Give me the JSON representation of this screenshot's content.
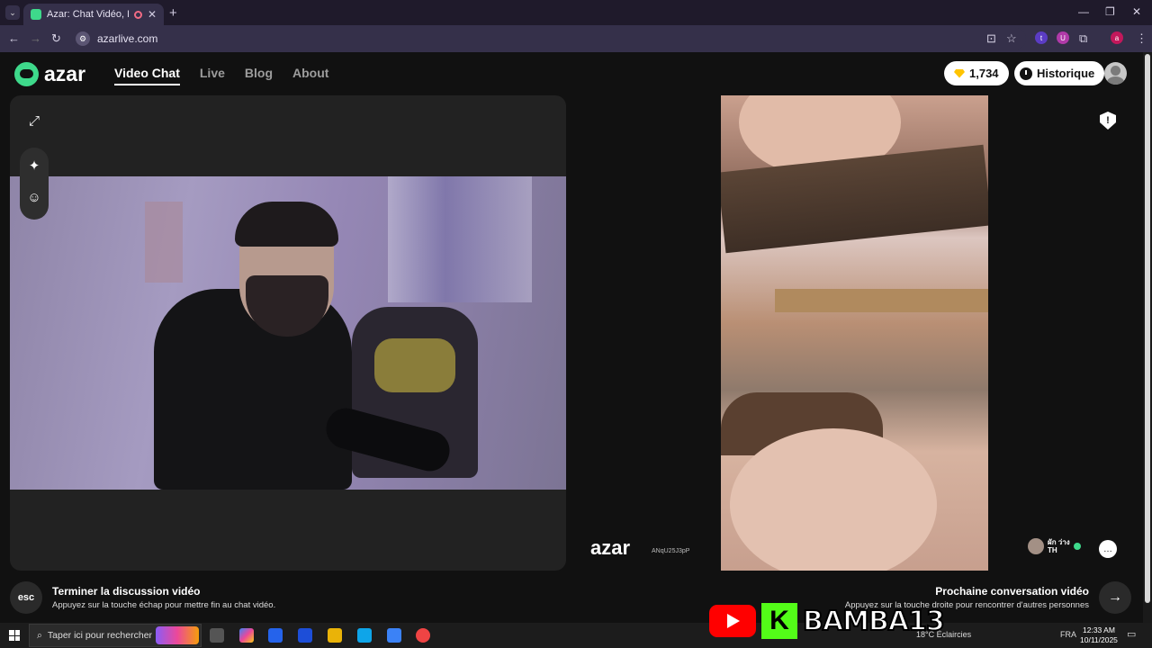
{
  "browser": {
    "tab_title": "Azar: Chat Vidéo, Rencontr",
    "tab_close": "✕",
    "new_tab": "+",
    "url": "azarlive.com",
    "window_controls": {
      "minimize": "—",
      "restore": "❐",
      "close": "✕"
    },
    "nav": {
      "back": "←",
      "forward": "→",
      "reload": "↻"
    },
    "extensions": [
      {
        "name": "t-extension",
        "label": "t",
        "color": "#5b3cc4"
      },
      {
        "name": "u-extension",
        "label": "U",
        "color": "#b03aa8"
      },
      {
        "name": "profile",
        "label": "a",
        "color": "#c2185b"
      }
    ]
  },
  "header": {
    "logo_text": "azar",
    "nav": [
      "Video Chat",
      "Live",
      "Blog",
      "About"
    ],
    "active_nav": "Video Chat",
    "gems": "1,734",
    "history_label": "Historique"
  },
  "video": {
    "watermark": "azar",
    "session_id": "ANqU25J3pP",
    "peer": {
      "name": "ผัก ว่าง",
      "country": "TH"
    }
  },
  "footer": {
    "esc_key": "esc",
    "end_title": "Terminer la discussion vidéo",
    "end_sub": "Appuyez sur la touche échap pour mettre fin au chat vidéo.",
    "next_title": "Prochaine conversation vidéo",
    "next_sub": "Appuyez sur la touche droite pour rencontrer d'autres personnes",
    "next_arrow": "→"
  },
  "stream_overlay": {
    "channel": "BAMBA13",
    "kick_letter": "K"
  },
  "taskbar": {
    "search_placeholder": "Taper ici pour rechercher",
    "weather": "18°C  Éclaircies",
    "language": "FRA",
    "time": "12:33 AM",
    "date": "10/11/2025"
  }
}
